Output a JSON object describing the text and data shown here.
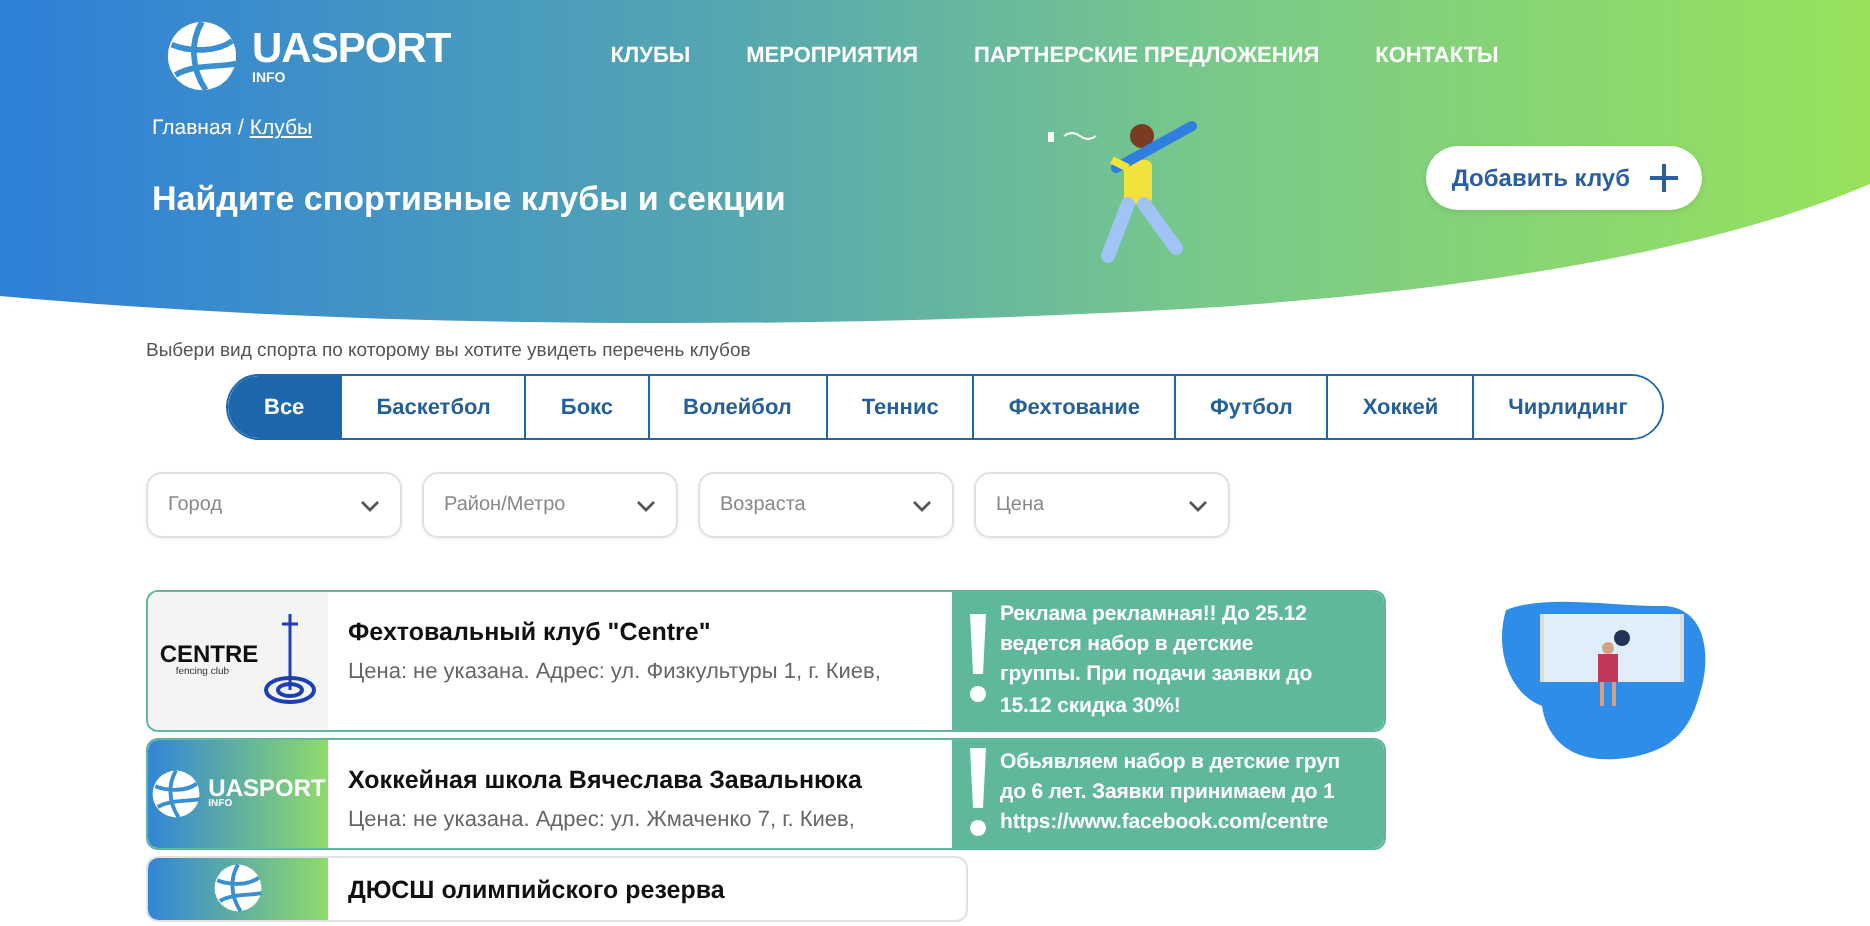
{
  "header": {
    "logo": {
      "title": "UASPORT",
      "subtitle": "INFO"
    },
    "nav": [
      {
        "label": "КЛУБЫ"
      },
      {
        "label": "МЕРОПРИЯТИЯ"
      },
      {
        "label": "ПАРТНЕРСКИЕ ПРЕДЛОЖЕНИЯ"
      },
      {
        "label": "КОНТАКТЫ"
      }
    ],
    "breadcrumb_separator": "/",
    "breadcrumb": [
      {
        "label": "Главная",
        "link": false
      },
      {
        "label": "Клубы",
        "link": true
      }
    ],
    "title": "Найдите спортивные клубы и секции",
    "add_button": {
      "label": "Добавить клуб"
    }
  },
  "sports": {
    "hint": "Выбери вид спорта по которому вы хотите увидеть перечень клубов",
    "tabs": [
      {
        "label": "Все",
        "selected": true
      },
      {
        "label": "Баскетбол",
        "selected": false
      },
      {
        "label": "Бокс",
        "selected": false
      },
      {
        "label": "Волейбол",
        "selected": false
      },
      {
        "label": "Теннис",
        "selected": false
      },
      {
        "label": "Фехтование",
        "selected": false
      },
      {
        "label": "Футбол",
        "selected": false
      },
      {
        "label": "Хоккей",
        "selected": false
      },
      {
        "label": "Чирлидинг",
        "selected": false
      }
    ]
  },
  "filters": [
    {
      "placeholder": "Город"
    },
    {
      "placeholder": "Район/Метро"
    },
    {
      "placeholder": "Возраста"
    },
    {
      "placeholder": "Цена"
    }
  ],
  "clubs": [
    {
      "logo": {
        "kind": "fencing",
        "title": "CENTRE",
        "subtitle": "fencing club"
      },
      "name": "Фехтовальный клуб \"Centre\"",
      "details": "Цена: не указана. Адрес: ул. Физкультуры 1, г. Киев,",
      "ad": {
        "lines": [
          "Реклама рекламная!! До 25.12",
          "ведется набор в детские",
          "группы. При подачи заявки до",
          "15.12 скидка 30%!"
        ]
      }
    },
    {
      "logo": {
        "kind": "brand",
        "title": "UASPORT",
        "subtitle": "INFO"
      },
      "name": "Хоккейная школа Вячеслава Завальнюка",
      "details": "Цена: не указана. Адрес: ул. Жмаченко 7, г. Киев,",
      "ad": {
        "lines": [
          "Обьявляем набор в детские груп",
          "до 6 лет. Заявки принимаем до 1",
          "https://www.facebook.com/centre"
        ]
      }
    },
    {
      "logo": {
        "kind": "brand"
      },
      "name": "ДЮСШ олимпийского резерва"
    }
  ]
}
